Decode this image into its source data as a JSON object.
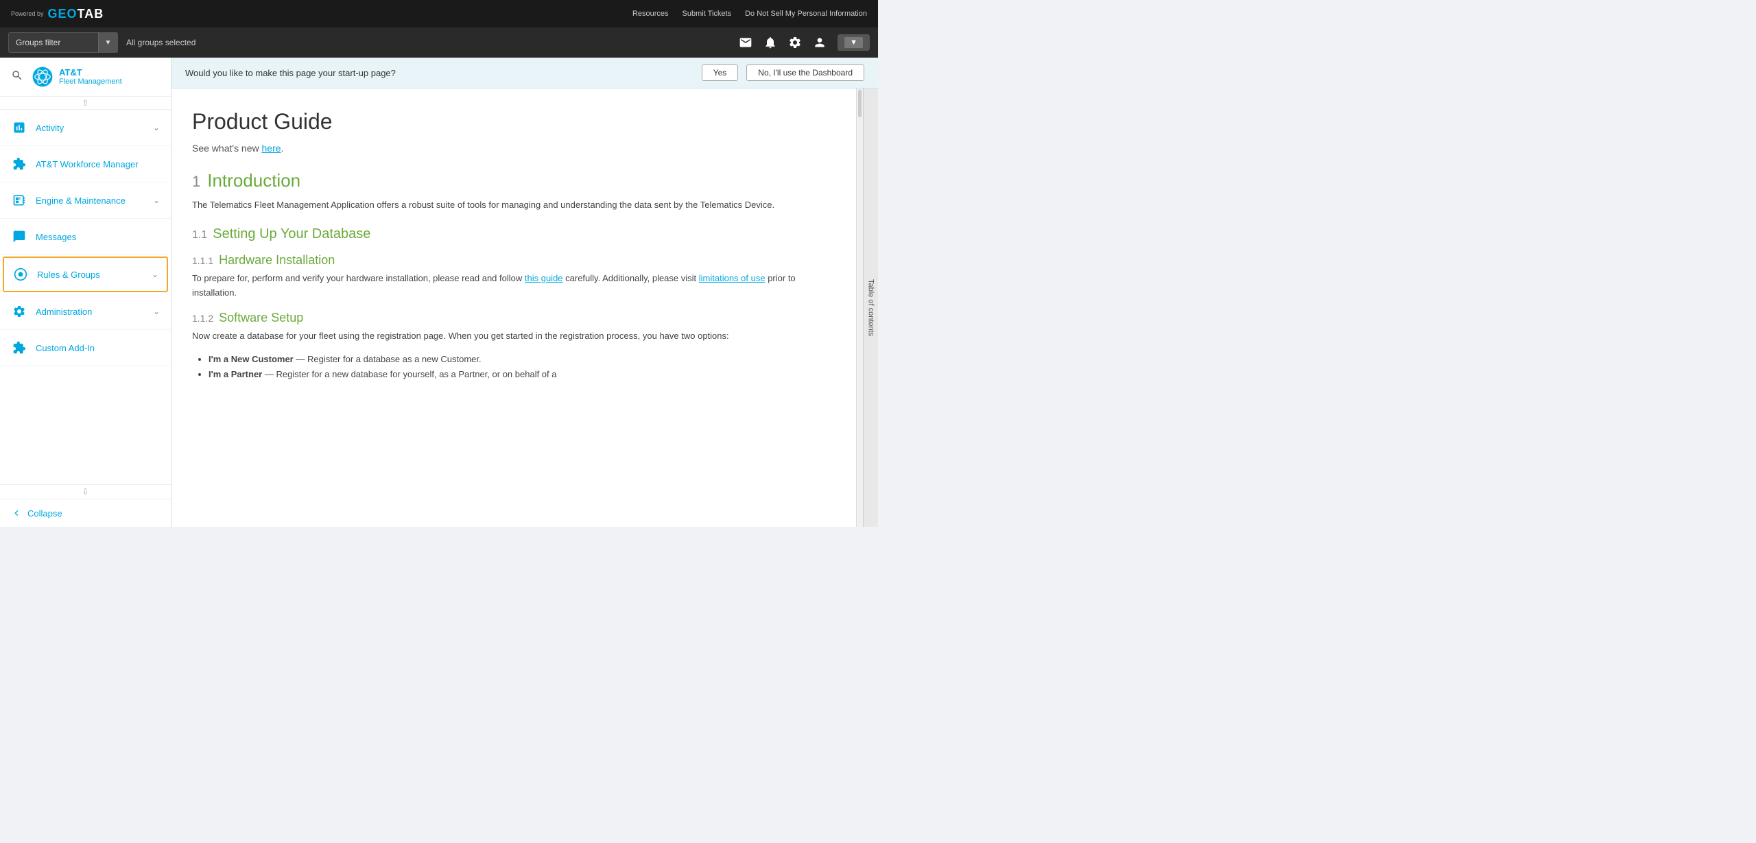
{
  "topbar": {
    "powered_by": "Powered\nby",
    "logo_text": "GEOTAB",
    "links": [
      "Resources",
      "Submit Tickets",
      "Do Not Sell My Personal Information"
    ]
  },
  "filterbar": {
    "groups_filter_label": "Groups filter",
    "all_groups_text": "All groups selected",
    "icons": [
      "mail",
      "bell",
      "gear",
      "user"
    ]
  },
  "sidebar": {
    "search_placeholder": "Search",
    "brand_name": "AT&T",
    "brand_sub": "Fleet Management",
    "nav_items": [
      {
        "id": "activity",
        "label": "Activity",
        "has_chevron": true,
        "active": false
      },
      {
        "id": "att-workforce",
        "label": "AT&T Workforce Manager",
        "has_chevron": false,
        "active": false
      },
      {
        "id": "engine-maintenance",
        "label": "Engine & Maintenance",
        "has_chevron": true,
        "active": false
      },
      {
        "id": "messages",
        "label": "Messages",
        "has_chevron": false,
        "active": false
      },
      {
        "id": "rules-groups",
        "label": "Rules & Groups",
        "has_chevron": true,
        "active": true
      },
      {
        "id": "administration",
        "label": "Administration",
        "has_chevron": true,
        "active": false
      },
      {
        "id": "custom-add-in",
        "label": "Custom Add-In",
        "has_chevron": false,
        "active": false
      }
    ],
    "collapse_label": "Collapse"
  },
  "startup_banner": {
    "question": "Would you like to make this page your start-up page?",
    "btn_yes": "Yes",
    "btn_no": "No, I'll use the Dashboard"
  },
  "doc": {
    "title": "Product Guide",
    "subtitle_text": "See what's new ",
    "subtitle_link": "here",
    "subtitle_end": ".",
    "sections": [
      {
        "num": "1",
        "title": "Introduction",
        "para": "The Telematics Fleet Management Application offers a robust suite of tools for managing and understanding the data sent by the Telematics Device.",
        "subsections": [
          {
            "num": "1.1",
            "title": "Setting Up Your Database",
            "sub2": [
              {
                "num": "1.1.1",
                "title": "Hardware Installation",
                "para_before_link": "To prepare for, perform and verify your hardware installation, please read and follow ",
                "link1": "this guide",
                "para_middle": " carefully. Additionally, please visit ",
                "link2": "limitations of use",
                "para_after": " prior to installation."
              },
              {
                "num": "1.1.2",
                "title": "Software Setup",
                "para": "Now create a database for your fleet using the registration page. When you get started in the registration process, you have two options:",
                "bullets": [
                  {
                    "bold": "I'm a New Customer",
                    "text": " — Register for a database as a new Customer."
                  },
                  {
                    "bold": "I'm a Partner",
                    "text": " — Register for a new database for yourself, as a Partner, or on behalf of a"
                  }
                ]
              }
            ]
          }
        ]
      }
    ],
    "toc_label": "Table of contents"
  }
}
